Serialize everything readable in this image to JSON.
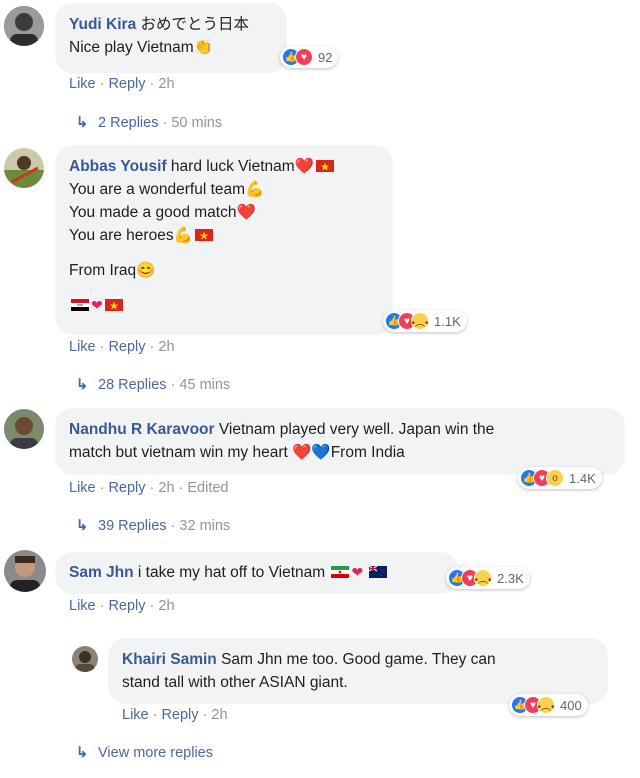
{
  "comments": [
    {
      "author": "Yudi Kira",
      "text_inline": "おめでとう日本",
      "lines": [
        "Nice play Vietnam👏"
      ],
      "reaction_count": "92",
      "actions": {
        "like": "Like",
        "reply": "Reply",
        "time": "2h"
      },
      "replies": {
        "count_label": "2 Replies",
        "time": "50 mins"
      }
    },
    {
      "author": "Abbas Yousif",
      "text_inline": "hard luck Vietnam❤️",
      "lines": [
        "You are a wonderful team💪",
        "You made a good match❤️",
        "You are heroes💪",
        "From Iraq😊"
      ],
      "reaction_count": "1.1K",
      "actions": {
        "like": "Like",
        "reply": "Reply",
        "time": "2h"
      },
      "replies": {
        "count_label": "28 Replies",
        "time": "45 mins"
      }
    },
    {
      "author": "Nandhu R Karavoor",
      "text_inline": "Vietnam played very well. Japan win the",
      "lines": [
        "match but vietnam win my heart ❤️💙From India"
      ],
      "reaction_count": "1.4K",
      "actions": {
        "like": "Like",
        "reply": "Reply",
        "time": "2h",
        "edited": "Edited"
      },
      "replies": {
        "count_label": "39 Replies",
        "time": "32 mins"
      }
    },
    {
      "author": "Sam Jhn",
      "text_inline": "i take my hat off to Vietnam",
      "reaction_count": "2.3K",
      "actions": {
        "like": "Like",
        "reply": "Reply",
        "time": "2h"
      }
    }
  ],
  "reply": {
    "author": "Khairi Samin",
    "text_inline": "Sam Jhn me too. Good game. They can",
    "lines": [
      "stand tall with other ASIAN giant."
    ],
    "reaction_count": "400",
    "actions": {
      "like": "Like",
      "reply": "Reply",
      "time": "2h"
    }
  },
  "view_more": "View more replies",
  "colors": {
    "link": "#385898",
    "bubble": "#f2f3f5",
    "meta": "#90949c",
    "like": "#2078f4",
    "love": "#f33e58"
  }
}
